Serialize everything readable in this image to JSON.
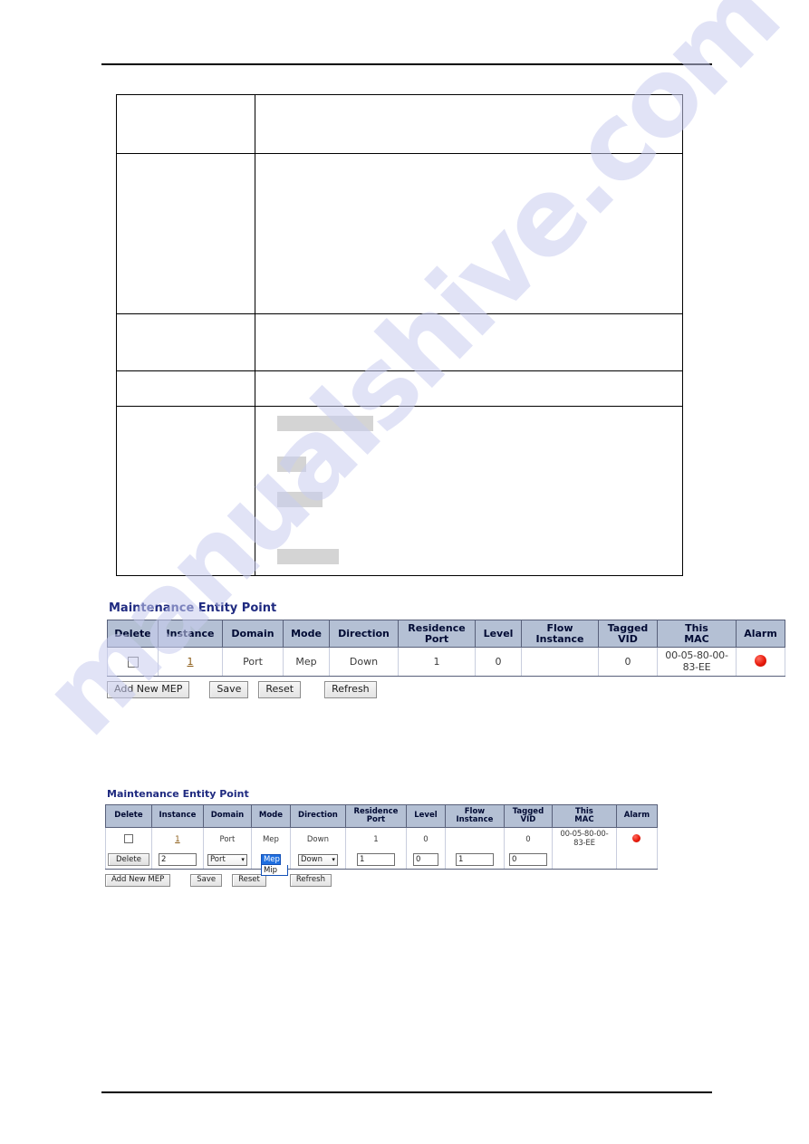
{
  "document": {
    "spec_table": {
      "rows": [
        {
          "label": "",
          "content": "",
          "boxes": []
        },
        {
          "label": "",
          "content": "",
          "boxes": []
        },
        {
          "label": "",
          "content": "",
          "boxes": []
        },
        {
          "label": "",
          "content": "",
          "boxes": []
        },
        {
          "label": "",
          "content": "",
          "boxes": [
            "",
            "",
            "",
            ""
          ]
        }
      ]
    },
    "watermark": "manualshive.com"
  },
  "panel_one": {
    "title": "Maintenance Entity Point",
    "columns": [
      "Delete",
      "Instance",
      "Domain",
      "Mode",
      "Direction",
      "Residence Port",
      "Level",
      "Flow Instance",
      "Tagged VID",
      "This MAC",
      "Alarm"
    ],
    "column_lines": [
      [
        "Delete"
      ],
      [
        "Instance"
      ],
      [
        "Domain"
      ],
      [
        "Mode"
      ],
      [
        "Direction"
      ],
      [
        "Residence",
        "Port"
      ],
      [
        "Level"
      ],
      [
        "Flow",
        "Instance"
      ],
      [
        "Tagged",
        "VID"
      ],
      [
        "This",
        "MAC"
      ],
      [
        "Alarm"
      ]
    ],
    "row": {
      "delete": "",
      "instance": "1",
      "domain": "Port",
      "mode": "Mep",
      "direction": "Down",
      "residence_port": "1",
      "level": "0",
      "flow_instance": "",
      "tagged_vid": "0",
      "this_mac_line1": "00-05-80-00-",
      "this_mac_line2": "83-EE",
      "alarm": "red"
    },
    "buttons": {
      "add_new_mep": "Add New MEP",
      "save": "Save",
      "reset": "Reset",
      "refresh": "Refresh"
    }
  },
  "panel_two": {
    "title": "Maintenance Entity Point",
    "column_lines": [
      [
        "Delete"
      ],
      [
        "Instance"
      ],
      [
        "Domain"
      ],
      [
        "Mode"
      ],
      [
        "Direction"
      ],
      [
        "Residence",
        "Port"
      ],
      [
        "Level"
      ],
      [
        "Flow",
        "Instance"
      ],
      [
        "Tagged",
        "VID"
      ],
      [
        "This",
        "MAC"
      ],
      [
        "Alarm"
      ]
    ],
    "row": {
      "delete": "",
      "instance": "1",
      "domain": "Port",
      "mode": "Mep",
      "direction": "Down",
      "residence_port": "1",
      "level": "0",
      "flow_instance": "",
      "tagged_vid": "0",
      "this_mac_line1": "00-05-80-00-",
      "this_mac_line2": "83-EE",
      "alarm": "red"
    },
    "edit_row": {
      "delete_button": "Delete",
      "instance_value": "2",
      "domain_value": "Port",
      "mode_value": "Mep",
      "mode_options": [
        "Mep",
        "Mip"
      ],
      "direction_value": "Down",
      "residence_port_value": "1",
      "level_value": "0",
      "flow_instance_value": "1",
      "tagged_vid_value": "0"
    },
    "buttons": {
      "add_new_mep": "Add New MEP",
      "save": "Save",
      "reset": "Reset",
      "refresh": "Refresh"
    }
  },
  "colors": {
    "header_bg": "#b4c0d4",
    "header_text": "#000a33",
    "title_text": "#1f2a80",
    "alarm_red": "#e81b0c",
    "select_highlight": "#1f6fe0",
    "watermark": "#c9cdf0"
  }
}
